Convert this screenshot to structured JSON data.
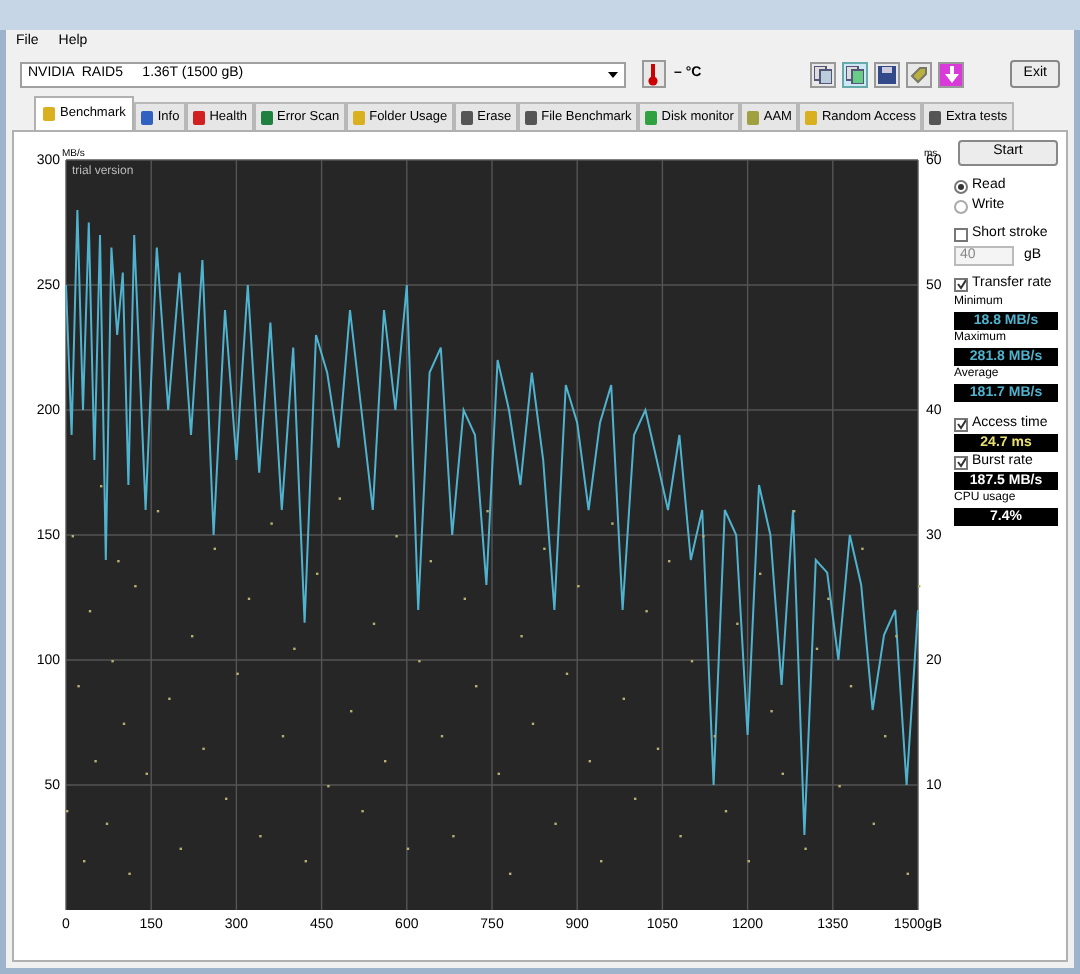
{
  "menu": [
    "File",
    "Help"
  ],
  "drive": {
    "value": "NVIDIA  RAID5     1.36T (1500 gB)"
  },
  "temperature": "– °C",
  "exit": "Exit",
  "tabs": [
    {
      "label": "Benchmark",
      "selected": true
    },
    {
      "label": "Info",
      "selected": false
    },
    {
      "label": "Health",
      "selected": false
    },
    {
      "label": "Error Scan",
      "selected": false
    },
    {
      "label": "Folder Usage",
      "selected": false
    },
    {
      "label": "Erase",
      "selected": false
    },
    {
      "label": "File Benchmark",
      "selected": false
    },
    {
      "label": "Disk monitor",
      "selected": false
    },
    {
      "label": "AAM",
      "selected": false
    },
    {
      "label": "Random Access",
      "selected": false
    },
    {
      "label": "Extra tests",
      "selected": false
    }
  ],
  "chart": {
    "left_unit": "MB/s",
    "right_unit": "ms",
    "watermark": "trial version",
    "chart_data": {
      "type": "line",
      "grid": true,
      "xlim": [
        0,
        1500
      ],
      "ylim": [
        0,
        300
      ],
      "xticks": [
        0,
        150,
        300,
        450,
        600,
        750,
        900,
        1050,
        1200,
        1350,
        {
          "value": 1500,
          "label": "1500gB"
        }
      ],
      "yticks": [
        50,
        100,
        150,
        200,
        250,
        300
      ],
      "y2ticks": [
        "10",
        "20",
        "30",
        "40",
        "50",
        "60"
      ],
      "x": [
        0,
        10,
        20,
        30,
        40,
        50,
        60,
        70,
        80,
        90,
        100,
        110,
        120,
        140,
        160,
        180,
        200,
        220,
        240,
        260,
        280,
        300,
        320,
        340,
        360,
        380,
        400,
        420,
        440,
        460,
        480,
        500,
        520,
        540,
        560,
        580,
        600,
        620,
        640,
        660,
        680,
        700,
        720,
        740,
        760,
        780,
        800,
        820,
        840,
        860,
        880,
        900,
        920,
        940,
        960,
        980,
        1000,
        1020,
        1040,
        1060,
        1080,
        1100,
        1120,
        1140,
        1160,
        1180,
        1200,
        1220,
        1240,
        1260,
        1280,
        1300,
        1320,
        1340,
        1360,
        1380,
        1400,
        1420,
        1440,
        1460,
        1480,
        1500
      ],
      "series": [
        {
          "color": "#4fb3cf",
          "values": [
            250,
            190,
            280,
            200,
            275,
            180,
            270,
            140,
            265,
            230,
            255,
            170,
            270,
            160,
            265,
            200,
            255,
            190,
            260,
            150,
            240,
            180,
            250,
            175,
            235,
            160,
            225,
            115,
            230,
            215,
            185,
            240,
            200,
            160,
            240,
            200,
            250,
            120,
            215,
            225,
            150,
            200,
            190,
            130,
            220,
            200,
            170,
            215,
            180,
            120,
            210,
            195,
            160,
            195,
            210,
            120,
            190,
            200,
            180,
            160,
            190,
            140,
            160,
            50,
            160,
            150,
            70,
            170,
            150,
            90,
            160,
            30,
            140,
            135,
            100,
            150,
            130,
            80,
            110,
            120,
            50,
            120
          ]
        },
        {
          "type": "scatter",
          "color": "#b8b070",
          "values": [
            40,
            150,
            90,
            20,
            120,
            60,
            170,
            35,
            100,
            140,
            75,
            15,
            130,
            55,
            160,
            85,
            25,
            110,
            65,
            145,
            45,
            95,
            125,
            30,
            155,
            70,
            105,
            20,
            135,
            50,
            165,
            80,
            40,
            115,
            60,
            150,
            25,
            100,
            140,
            70,
            30,
            125,
            90,
            160,
            55,
            15,
            110,
            75,
            145,
            35,
            95,
            130,
            60,
            20,
            155,
            85,
            45,
            120,
            65,
            140,
            30,
            100,
            150,
            70,
            40,
            115,
            20,
            135,
            80,
            55,
            160,
            25,
            105,
            125,
            50,
            90,
            145,
            35,
            70,
            110,
            15,
            130
          ]
        }
      ]
    }
  },
  "controls": {
    "start": "Start",
    "modes": [
      {
        "label": "Read",
        "selected": true
      },
      {
        "label": "Write",
        "selected": false
      }
    ],
    "short_stroke": {
      "label": "Short stroke",
      "checked": false
    },
    "stroke_value": "40",
    "stroke_unit": "gB",
    "transfer_rate": {
      "label": "Transfer rate",
      "checked": true
    },
    "stats": [
      {
        "label": "Minimum",
        "value": "18.8 MB/s"
      },
      {
        "label": "Maximum",
        "value": "281.8 MB/s"
      },
      {
        "label": "Average",
        "value": "181.7 MB/s"
      }
    ],
    "access_time": {
      "label": "Access time",
      "checked": true,
      "value": "24.7 ms"
    },
    "burst_rate": {
      "label": "Burst rate",
      "checked": true,
      "value": "187.5 MB/s"
    },
    "cpu": {
      "label": "CPU usage",
      "value": "7.4%"
    }
  }
}
